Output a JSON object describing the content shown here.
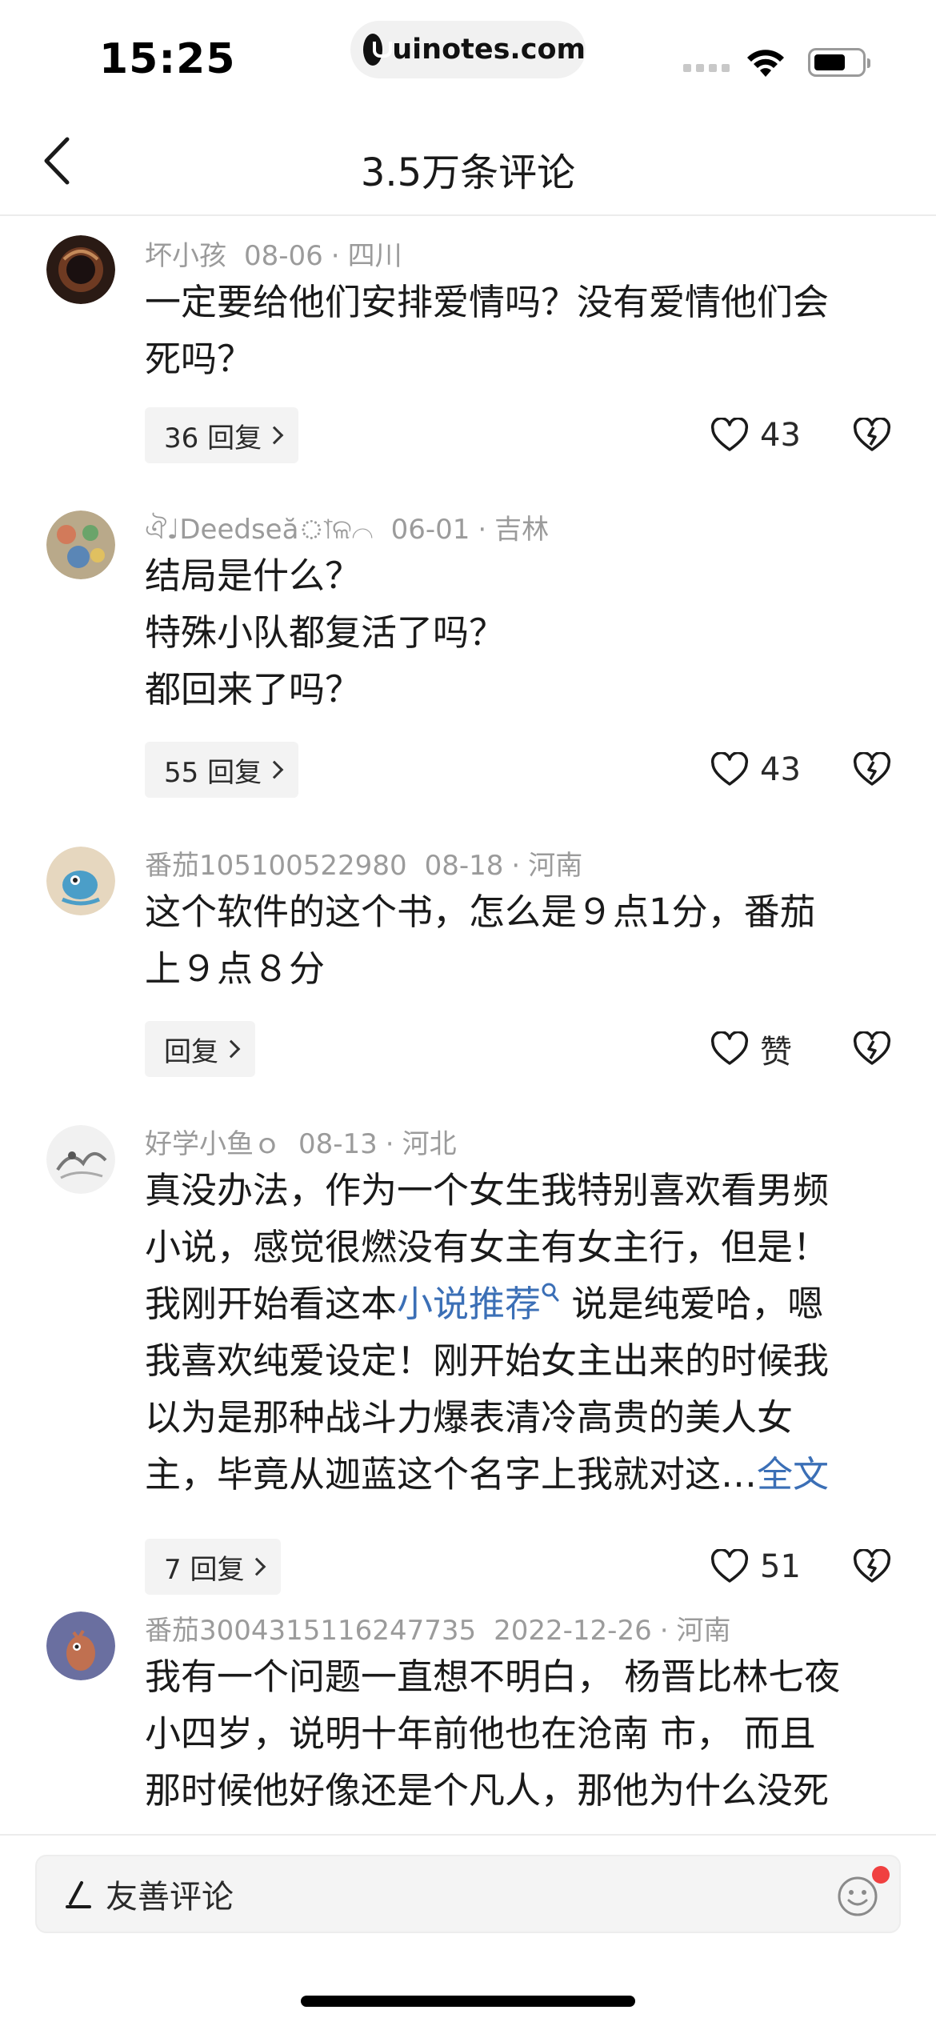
{
  "status_bar": {
    "time": "15:25",
    "url": "uinotes.com"
  },
  "nav": {
    "title": "3.5万条评论"
  },
  "comments": [
    {
      "username": "坏小孩",
      "date": "08-06",
      "location": "四川",
      "lines": [
        "一定要给他们安排爱情吗？没有爱情他们会",
        "死吗？"
      ],
      "reply_label": "36 回复",
      "likes": "43"
    },
    {
      "username": "ঐ♩Deedseăাଳ⌒",
      "date": "06-01",
      "location": "吉林",
      "lines": [
        "结局是什么？",
        "特殊小队都复活了吗？",
        "都回来了吗？"
      ],
      "reply_label": "55 回复",
      "likes": "43"
    },
    {
      "username": "番茄105100522980",
      "date": "08-18",
      "location": "河南",
      "lines": [
        "这个软件的这个书，怎么是９点1分，番茄",
        "上９点８分"
      ],
      "reply_label": "回复",
      "likes": "赞"
    },
    {
      "username": "好学小鱼ｏ",
      "date": "08-13",
      "location": "河北",
      "lines": [
        "真没办法，作为一个女生我特别喜欢看男频",
        "小说，感觉很燃没有女主有女主行，但是！"
      ],
      "line3_before": "我刚开始看这本",
      "line3_link": "小说推荐",
      "line3_after": " 说是纯爱哈，嗯",
      "lines_after": [
        "我喜欢纯爱设定！刚开始女主出来的时候我",
        "以为是那种战斗力爆表清冷高贵的美人女"
      ],
      "last_line": "主，毕竟从迦蓝这个名字上我就对这…",
      "expand_label": "全文",
      "reply_label": "7 回复",
      "likes": "51"
    },
    {
      "username": "番茄3004315116247735",
      "date": "2022-12-26",
      "location": "河南",
      "lines": [
        "我有一个问题一直想不明白， 杨晋比林七夜",
        "小四岁，说明十年前他也在沧南 市， 而且",
        "那时候他好像还是个凡人，那他为什么没死"
      ]
    }
  ],
  "bottom": {
    "placeholder": "友善评论"
  },
  "colors": {
    "link": "#3b6fb6",
    "meta": "#9b9b9b",
    "badge": "#f04040"
  }
}
